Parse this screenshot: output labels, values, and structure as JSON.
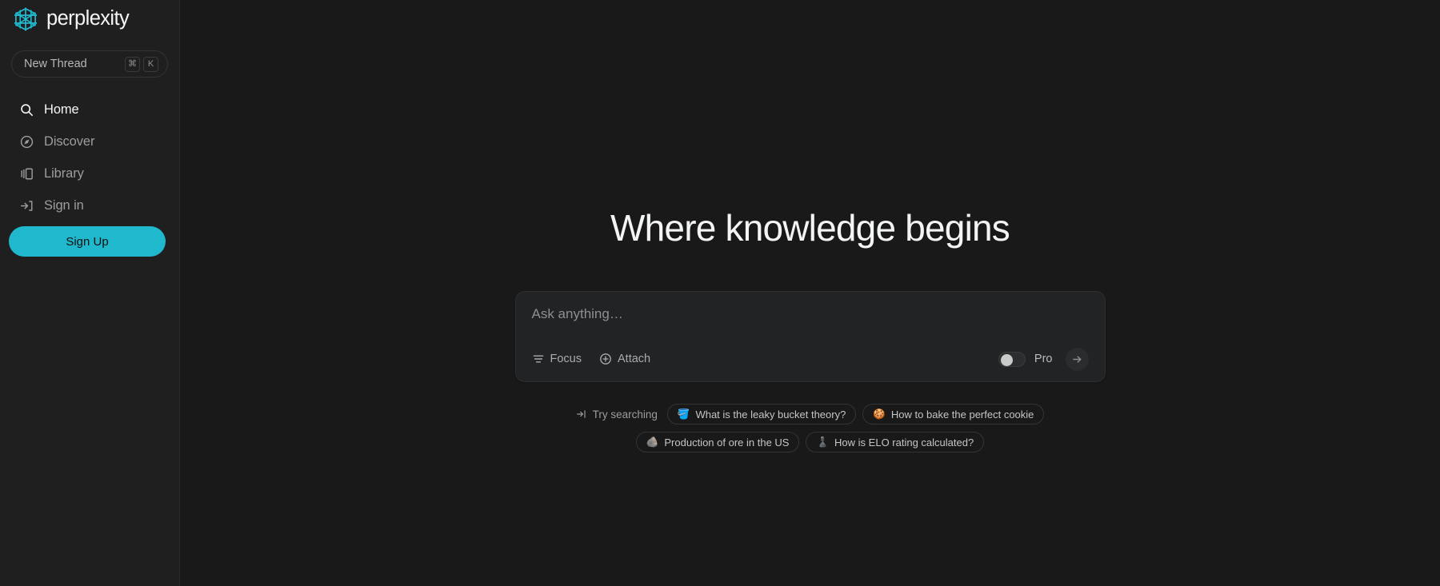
{
  "brand": {
    "name": "perplexity",
    "logo_icon": "perplexity-asterisk-icon",
    "accent_color": "#20b8cd"
  },
  "sidebar": {
    "new_thread": {
      "label": "New Thread",
      "keys": [
        "⌘",
        "K"
      ]
    },
    "items": [
      {
        "label": "Home",
        "icon": "search-icon",
        "active": true
      },
      {
        "label": "Discover",
        "icon": "compass-icon",
        "active": false
      },
      {
        "label": "Library",
        "icon": "library-icon",
        "active": false
      },
      {
        "label": "Sign in",
        "icon": "login-icon",
        "active": false
      }
    ],
    "signup_label": "Sign Up"
  },
  "main": {
    "headline": "Where knowledge begins",
    "ask": {
      "placeholder": "Ask anything…",
      "value": "",
      "focus_label": "Focus",
      "focus_icon": "filter-icon",
      "attach_label": "Attach",
      "attach_icon": "circle-plus-icon",
      "pro_label": "Pro",
      "pro_enabled": false,
      "submit_icon": "arrow-right-icon"
    },
    "suggestions": {
      "try_label": "Try searching",
      "try_icon": "arrow-into-bracket-icon",
      "rows": [
        [
          {
            "emoji": "🪣",
            "label": "What is the leaky bucket theory?"
          },
          {
            "emoji": "🍪",
            "label": "How to bake the perfect cookie"
          }
        ],
        [
          {
            "emoji": "🪨",
            "label": "Production of ore in the US"
          },
          {
            "emoji": "♟️",
            "label": "How is ELO rating calculated?"
          }
        ]
      ]
    }
  }
}
